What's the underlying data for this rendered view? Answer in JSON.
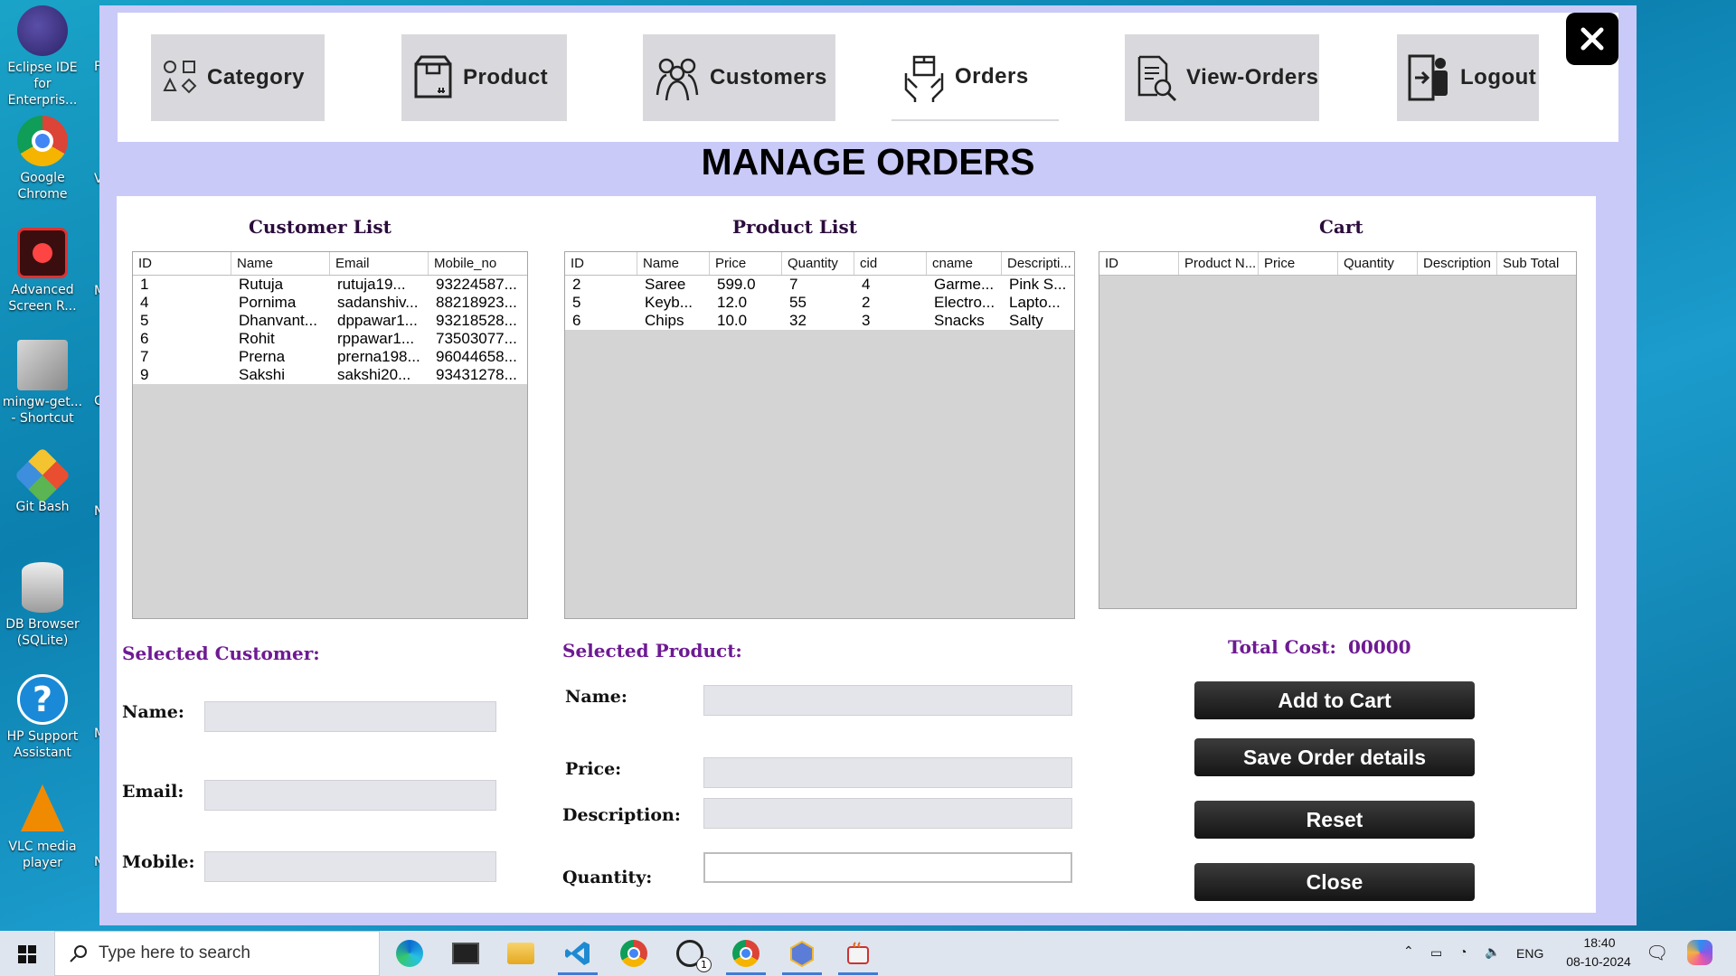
{
  "desktop": {
    "icons": [
      {
        "label": "Eclipse IDE for Enterpris..."
      },
      {
        "label": "Google Chrome"
      },
      {
        "label": "Advanced Screen R..."
      },
      {
        "label": "mingw-get... - Shortcut"
      },
      {
        "label": "Git Bash"
      },
      {
        "label": "DB Browser (SQLite)"
      },
      {
        "label": "HP Support Assistant"
      },
      {
        "label": "VLC media player"
      }
    ],
    "edge_letters": [
      "F",
      "V",
      "M",
      "C",
      "N",
      "M",
      "N"
    ]
  },
  "nav": {
    "category": "Category",
    "product": "Product",
    "customers": "Customers",
    "orders": "Orders",
    "view_orders": "View-Orders",
    "logout": "Logout"
  },
  "title": "MANAGE ORDERS",
  "customer_list": {
    "title": "Customer List",
    "columns": [
      "ID",
      "Name",
      "Email",
      "Mobile_no"
    ],
    "rows": [
      [
        "1",
        "Rutuja",
        "rutuja19...",
        "93224587..."
      ],
      [
        "4",
        "Pornima",
        "sadanshiv...",
        "88218923..."
      ],
      [
        "5",
        "Dhanvant...",
        "dppawar1...",
        "93218528..."
      ],
      [
        "6",
        "Rohit",
        "rppawar1...",
        "73503077..."
      ],
      [
        "7",
        "Prerna",
        "prerna198...",
        "96044658..."
      ],
      [
        "9",
        " Sakshi",
        "sakshi20...",
        "93431278..."
      ]
    ]
  },
  "product_list": {
    "title": "Product List",
    "columns": [
      "ID",
      "Name",
      "Price",
      "Quantity",
      "cid",
      "cname",
      "Descripti..."
    ],
    "rows": [
      [
        "2",
        "Saree",
        "599.0",
        "7",
        "4",
        "Garme...",
        "Pink S..."
      ],
      [
        "5",
        "Keyb...",
        "12.0",
        "55",
        "2",
        "Electro...",
        "Lapto..."
      ],
      [
        "6",
        "Chips",
        "10.0",
        "32",
        "3",
        "Snacks",
        "Salty"
      ]
    ]
  },
  "cart": {
    "title": "Cart",
    "columns": [
      "ID",
      "Product N...",
      "Price",
      "Quantity",
      "Description",
      "Sub Total"
    ]
  },
  "selected_customer": {
    "heading": "Selected Customer:",
    "name_label": "Name:",
    "email_label": "Email:",
    "mobile_label": "Mobile:"
  },
  "selected_product": {
    "heading": "Selected Product:",
    "name_label": "Name:",
    "price_label": "Price:",
    "description_label": "Description:",
    "quantity_label": "Quantity:"
  },
  "total": {
    "label": "Total Cost:",
    "value": "00000"
  },
  "buttons": {
    "add_to_cart": "Add to Cart",
    "save_order": "Save Order details",
    "reset": "Reset",
    "close": "Close"
  },
  "taskbar": {
    "search_placeholder": "Type here to search",
    "language": "ENG",
    "time": "18:40",
    "date": "08-10-2024",
    "whatsapp_badge": "1"
  },
  "colors": {
    "window_bg": "#c9caf7",
    "section_heading": "#6e1a93",
    "button_dark": "#1c1c1c"
  }
}
